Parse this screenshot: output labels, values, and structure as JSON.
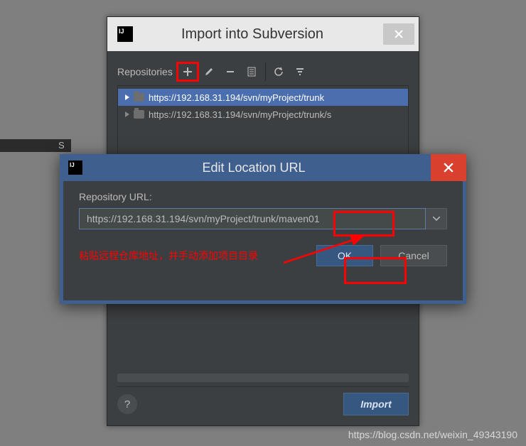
{
  "back": {
    "title": "Import into Subversion",
    "toolbar_label": "Repositories",
    "tree": [
      "https://192.168.31.194/svn/myProject/trunk",
      "https://192.168.31.194/svn/myProject/trunk/s"
    ],
    "import_btn": "Import",
    "help": "?"
  },
  "front": {
    "title": "Edit Location URL",
    "label": "Repository URL:",
    "url": "https://192.168.31.194/svn/myProject/trunk/maven01",
    "ok": "OK",
    "cancel": "Cancel"
  },
  "anno": {
    "text": "粘贴远程仓库地址，并手动添加项目目录"
  },
  "stripe": "S",
  "watermark": "https://blog.csdn.net/weixin_49343190"
}
